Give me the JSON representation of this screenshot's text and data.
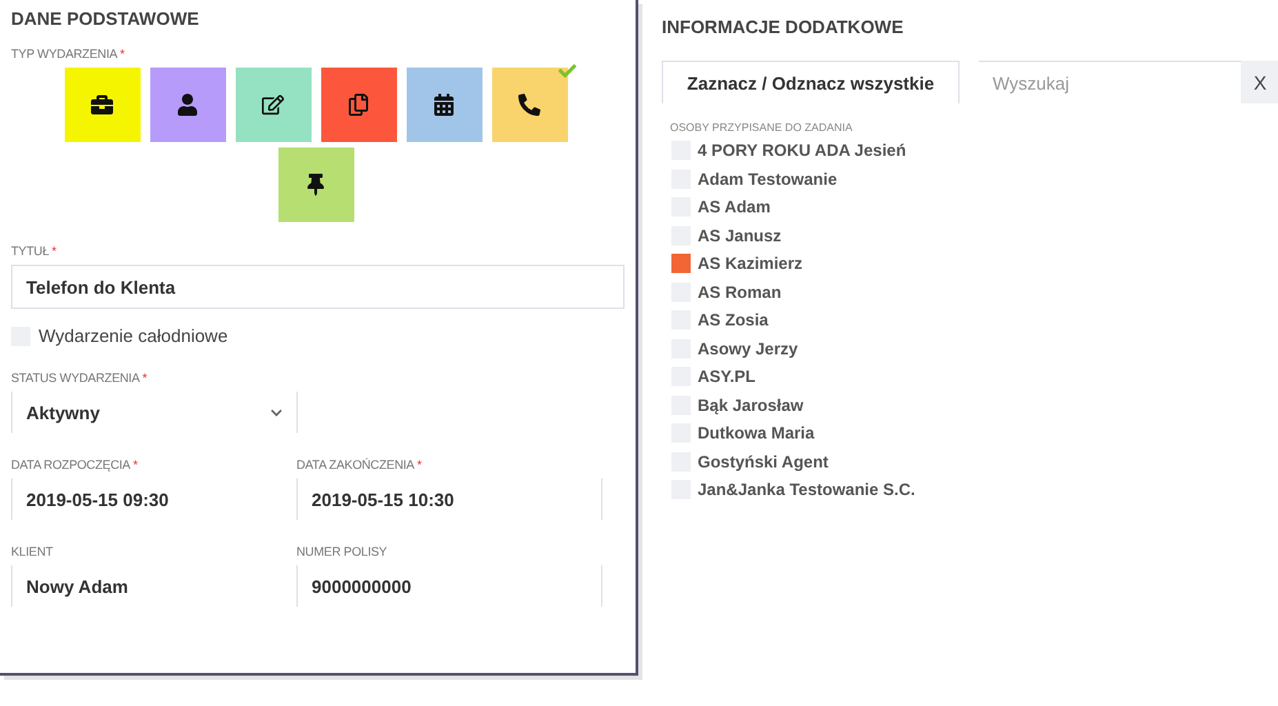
{
  "left": {
    "title": "DANE PODSTAWOWE",
    "event_type": {
      "label": "TYP WYDARZENIA",
      "required_mark": "*",
      "types": [
        {
          "kind": "briefcase",
          "color": "#f5f500",
          "selected": false
        },
        {
          "kind": "user",
          "color": "#b79bfb",
          "selected": false
        },
        {
          "kind": "edit",
          "color": "#95e2c3",
          "selected": false
        },
        {
          "kind": "copy",
          "color": "#fc573d",
          "selected": false
        },
        {
          "kind": "calendar",
          "color": "#a1c5e8",
          "selected": false
        },
        {
          "kind": "phone",
          "color": "#f9d46c",
          "selected": true
        },
        {
          "kind": "pin",
          "color": "#b6de70",
          "selected": false
        }
      ]
    },
    "title_field": {
      "label": "TYTUŁ",
      "required_mark": "*",
      "value": "Telefon do Klenta"
    },
    "all_day": {
      "label": "Wydarzenie całodniowe",
      "checked": false
    },
    "status": {
      "label": "STATUS WYDARZENIA",
      "required_mark": "*",
      "value": "Aktywny"
    },
    "pairs": [
      [
        {
          "label": "DATA ROZPOCZĘCIA",
          "required_mark": "*",
          "value": "2019-05-15 09:30"
        },
        {
          "label": "DATA ZAKOŃCZENIA",
          "required_mark": "*",
          "value": "2019-05-15 10:30"
        }
      ],
      [
        {
          "label": "KLIENT",
          "value": "Nowy Adam"
        },
        {
          "label": "NUMER POLISY",
          "value": "9000000000"
        }
      ]
    ]
  },
  "right": {
    "title": "INFORMACJE DODATKOWE",
    "toggle_all": "Zaznacz / Odznacz wszystkie",
    "search": {
      "placeholder": "Wyszukaj",
      "clear": "X"
    },
    "people_label": "OSOBY PRZYPISANE DO ZADANIA",
    "people": [
      {
        "name": "4 PORY ROKU ADA Jesień",
        "checked": false
      },
      {
        "name": "Adam Testowanie",
        "checked": false
      },
      {
        "name": "AS Adam",
        "checked": false
      },
      {
        "name": "AS Janusz",
        "checked": false
      },
      {
        "name": "AS Kazimierz",
        "checked": true
      },
      {
        "name": "AS Roman",
        "checked": false
      },
      {
        "name": "AS Zosia",
        "checked": false
      },
      {
        "name": "Asowy Jerzy",
        "checked": false
      },
      {
        "name": "ASY.PL",
        "checked": false
      },
      {
        "name": "Bąk Jarosław",
        "checked": false
      },
      {
        "name": "Dutkowa Maria",
        "checked": false
      },
      {
        "name": "Gostyński Agent",
        "checked": false
      },
      {
        "name": "Jan&Janka Testowanie S.C.",
        "checked": false
      }
    ]
  }
}
